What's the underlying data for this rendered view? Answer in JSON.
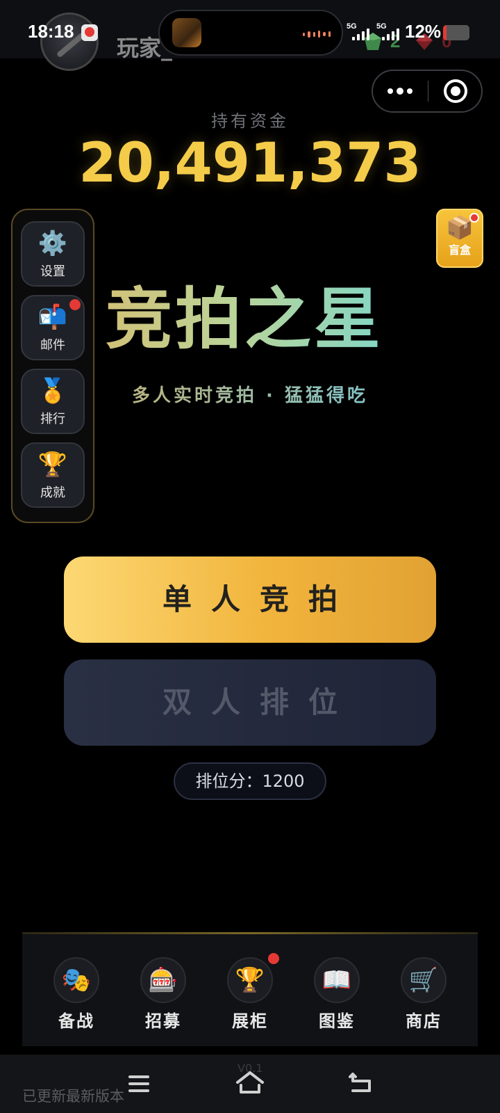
{
  "status_bar": {
    "time": "18:18",
    "signal_1": "5G",
    "signal_2": "5G",
    "battery_percent": "12%",
    "battery_level": 0.12,
    "green_gem_count": "2",
    "red_gem_count": "0"
  },
  "player": {
    "name": "玩家_"
  },
  "funds": {
    "label": "持有资金",
    "value": "20,491,373"
  },
  "side_menu": {
    "items": [
      {
        "label": "设置",
        "icon": "⚙️",
        "has_dot": false
      },
      {
        "label": "邮件",
        "icon": "📬",
        "has_dot": true
      },
      {
        "label": "排行",
        "icon": "🏅",
        "has_dot": false
      },
      {
        "label": "成就",
        "icon": "🏆",
        "has_dot": false
      }
    ]
  },
  "blind_box": {
    "label": "盲盒",
    "icon": "📦"
  },
  "title": {
    "main": "竞拍之星",
    "subtitle": "多人实时竞拍 · 猛猛得吃"
  },
  "buttons": {
    "single": "单人竞拍",
    "double": "双人排位"
  },
  "rank_score": "排位分：1200",
  "bottom_nav": {
    "items": [
      {
        "label": "备战",
        "icon": "🎭"
      },
      {
        "label": "招募",
        "icon": "🎰"
      },
      {
        "label": "展柜",
        "icon": "🏆"
      },
      {
        "label": "图鉴",
        "icon": "📖"
      },
      {
        "label": "商店",
        "icon": "🛒"
      }
    ]
  },
  "footer": {
    "update_text": "已更新最新版本",
    "version": "V0.1"
  },
  "colors": {
    "gold": "#f4cc4a",
    "accent_red": "#e53935",
    "dark_button": "#2a3044",
    "gold_button": "#f1b43c"
  }
}
